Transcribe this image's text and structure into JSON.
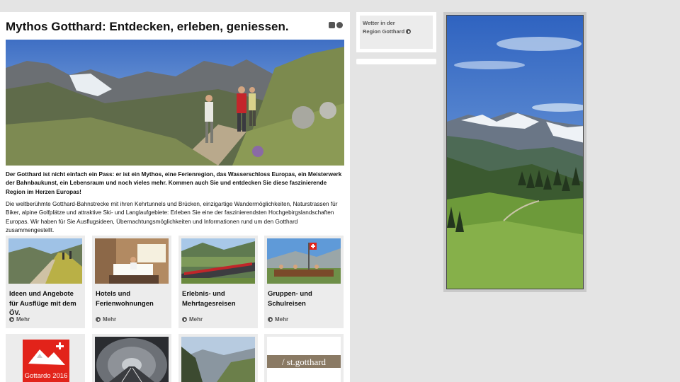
{
  "page": {
    "title": "Mythos Gotthard: Entdecken, erleben, geniessen.",
    "lead": "Der Gotthard ist nicht einfach ein Pass: er ist ein Mythos, eine Ferienregion, das Wasserschloss Europas, ein Meisterwerk der Bahnbaukunst, ein Lebensraum und noch vieles mehr. Kommen auch Sie und entdecken Sie diese faszinierende Region im Herzen Europas!",
    "body": "Die weltberühmte Gotthard-Bahnstrecke mit ihren Kehrtunnels und Brücken, einzigartige Wandermöglichkeiten, Naturstrassen für Biker, alpine Golfplätze und attraktive Ski- und Langlaufgebiete: Erleben Sie eine der faszinierendsten Hochgebirgslandschaften Europas. Wir haben für Sie Ausflugsideen, Übernachtungsmöglichkeiten und Informationen rund um den Gotthard zusammengestellt."
  },
  "tiles": [
    {
      "title": "Ideen und Angebote für Ausflüge mit dem ÖV.",
      "more": "Mehr"
    },
    {
      "title": "Hotels und Ferienwohnungen",
      "more": "Mehr"
    },
    {
      "title": "Erlebnis- und Mehrtagesreisen",
      "more": "Mehr"
    },
    {
      "title": "Gruppen- und Schulreisen",
      "more": "Mehr"
    }
  ],
  "bottom_tiles": {
    "gottardo_label": "Gottardo 2016",
    "stgotthard_label": "/ st.gotthard"
  },
  "sidebar": {
    "weather_line1": "Wetter in der",
    "weather_line2": "Region Gotthard"
  },
  "icons": {
    "comment": "comment-icon",
    "share": "share-icon",
    "more": "arrow-circle-icon"
  },
  "colors": {
    "background": "#e4e4e4",
    "tile_bg": "#ececec",
    "text": "#111111",
    "link_grey": "#555555",
    "swiss_red": "#e2231a"
  }
}
